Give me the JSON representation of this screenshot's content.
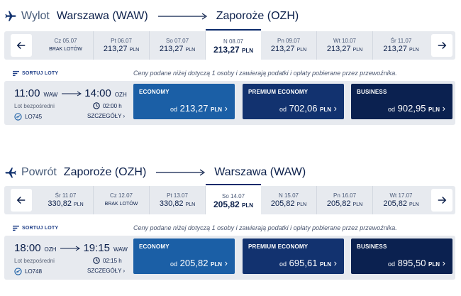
{
  "colors": {
    "navy": "#0b1f4a",
    "economy": "#1b5fa6",
    "premium": "#12326f",
    "business": "#0b2150",
    "bar": "#e7eaef"
  },
  "outbound": {
    "direction_label": "Wylot",
    "origin": "Warszawa (WAW)",
    "destination": "Zaporoże (OZH)",
    "dates": [
      {
        "day": "Cz 05.07",
        "status": "BRAK LOTÓW",
        "available": false,
        "selected": false
      },
      {
        "day": "Pt 06.07",
        "price": "213,27",
        "currency": "PLN",
        "available": true,
        "selected": false
      },
      {
        "day": "So 07.07",
        "price": "213,27",
        "currency": "PLN",
        "available": true,
        "selected": false
      },
      {
        "day": "N 08.07",
        "price": "213,27",
        "currency": "PLN",
        "available": true,
        "selected": true
      },
      {
        "day": "Pn 09.07",
        "price": "213,27",
        "currency": "PLN",
        "available": true,
        "selected": false
      },
      {
        "day": "Wt 10.07",
        "price": "213,27",
        "currency": "PLN",
        "available": true,
        "selected": false
      },
      {
        "day": "Śr 11.07",
        "price": "213,27",
        "currency": "PLN",
        "available": true,
        "selected": false
      }
    ],
    "sort_label": "SORTUJ LOTY",
    "notice": "Ceny podane niżej dotyczą 1 osoby i zawierają podatki i opłaty pobierane przez przewoźnika.",
    "flight": {
      "dep_time": "11:00",
      "dep_code": "WAW",
      "arr_time": "14:00",
      "arr_code": "OZH",
      "type": "Lot bezpośredni",
      "duration": "02:00 h",
      "flight_no": "LO745",
      "details_label": "SZCZEGÓŁY"
    },
    "fares": [
      {
        "class": "ECONOMY",
        "prefix": "od",
        "price": "213,27",
        "currency": "PLN"
      },
      {
        "class": "PREMIUM ECONOMY",
        "prefix": "od",
        "price": "702,06",
        "currency": "PLN"
      },
      {
        "class": "BUSINESS",
        "prefix": "od",
        "price": "902,95",
        "currency": "PLN"
      }
    ]
  },
  "return": {
    "direction_label": "Powrót",
    "origin": "Zaporoże (OZH)",
    "destination": "Warszawa (WAW)",
    "dates": [
      {
        "day": "Śr 11.07",
        "price": "330,82",
        "currency": "PLN",
        "available": true,
        "selected": false
      },
      {
        "day": "Cz 12.07",
        "status": "BRAK LOTÓW",
        "available": false,
        "selected": false
      },
      {
        "day": "Pt 13.07",
        "price": "330,82",
        "currency": "PLN",
        "available": true,
        "selected": false
      },
      {
        "day": "So 14.07",
        "price": "205,82",
        "currency": "PLN",
        "available": true,
        "selected": true
      },
      {
        "day": "N 15.07",
        "price": "205,82",
        "currency": "PLN",
        "available": true,
        "selected": false
      },
      {
        "day": "Pn 16.07",
        "price": "205,82",
        "currency": "PLN",
        "available": true,
        "selected": false
      },
      {
        "day": "Wt 17.07",
        "price": "205,82",
        "currency": "PLN",
        "available": true,
        "selected": false
      }
    ],
    "sort_label": "SORTUJ LOTY",
    "notice": "Ceny podane niżej dotyczą 1 osoby i zawierają podatki i opłaty pobierane przez przewoźnika.",
    "flight": {
      "dep_time": "18:00",
      "dep_code": "OZH",
      "arr_time": "19:15",
      "arr_code": "WAW",
      "type": "Lot bezpośredni",
      "duration": "02:15 h",
      "flight_no": "LO748",
      "details_label": "SZCZEGÓŁY"
    },
    "fares": [
      {
        "class": "ECONOMY",
        "prefix": "od",
        "price": "205,82",
        "currency": "PLN"
      },
      {
        "class": "PREMIUM ECONOMY",
        "prefix": "od",
        "price": "695,61",
        "currency": "PLN"
      },
      {
        "class": "BUSINESS",
        "prefix": "od",
        "price": "895,50",
        "currency": "PLN"
      }
    ]
  }
}
